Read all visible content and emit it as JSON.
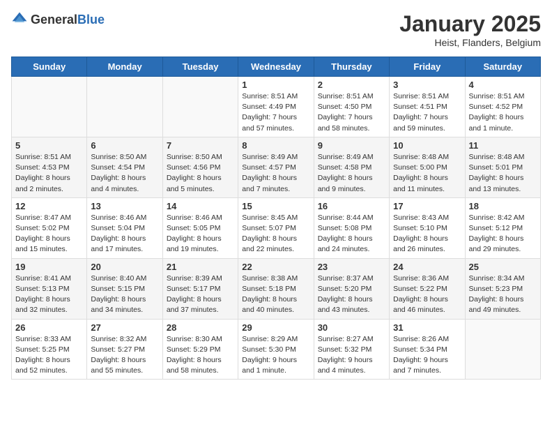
{
  "header": {
    "logo_general": "General",
    "logo_blue": "Blue",
    "month_title": "January 2025",
    "location": "Heist, Flanders, Belgium"
  },
  "days_of_week": [
    "Sunday",
    "Monday",
    "Tuesday",
    "Wednesday",
    "Thursday",
    "Friday",
    "Saturday"
  ],
  "weeks": [
    [
      {
        "day": "",
        "info": ""
      },
      {
        "day": "",
        "info": ""
      },
      {
        "day": "",
        "info": ""
      },
      {
        "day": "1",
        "info": "Sunrise: 8:51 AM\nSunset: 4:49 PM\nDaylight: 7 hours\nand 57 minutes."
      },
      {
        "day": "2",
        "info": "Sunrise: 8:51 AM\nSunset: 4:50 PM\nDaylight: 7 hours\nand 58 minutes."
      },
      {
        "day": "3",
        "info": "Sunrise: 8:51 AM\nSunset: 4:51 PM\nDaylight: 7 hours\nand 59 minutes."
      },
      {
        "day": "4",
        "info": "Sunrise: 8:51 AM\nSunset: 4:52 PM\nDaylight: 8 hours\nand 1 minute."
      }
    ],
    [
      {
        "day": "5",
        "info": "Sunrise: 8:51 AM\nSunset: 4:53 PM\nDaylight: 8 hours\nand 2 minutes."
      },
      {
        "day": "6",
        "info": "Sunrise: 8:50 AM\nSunset: 4:54 PM\nDaylight: 8 hours\nand 4 minutes."
      },
      {
        "day": "7",
        "info": "Sunrise: 8:50 AM\nSunset: 4:56 PM\nDaylight: 8 hours\nand 5 minutes."
      },
      {
        "day": "8",
        "info": "Sunrise: 8:49 AM\nSunset: 4:57 PM\nDaylight: 8 hours\nand 7 minutes."
      },
      {
        "day": "9",
        "info": "Sunrise: 8:49 AM\nSunset: 4:58 PM\nDaylight: 8 hours\nand 9 minutes."
      },
      {
        "day": "10",
        "info": "Sunrise: 8:48 AM\nSunset: 5:00 PM\nDaylight: 8 hours\nand 11 minutes."
      },
      {
        "day": "11",
        "info": "Sunrise: 8:48 AM\nSunset: 5:01 PM\nDaylight: 8 hours\nand 13 minutes."
      }
    ],
    [
      {
        "day": "12",
        "info": "Sunrise: 8:47 AM\nSunset: 5:02 PM\nDaylight: 8 hours\nand 15 minutes."
      },
      {
        "day": "13",
        "info": "Sunrise: 8:46 AM\nSunset: 5:04 PM\nDaylight: 8 hours\nand 17 minutes."
      },
      {
        "day": "14",
        "info": "Sunrise: 8:46 AM\nSunset: 5:05 PM\nDaylight: 8 hours\nand 19 minutes."
      },
      {
        "day": "15",
        "info": "Sunrise: 8:45 AM\nSunset: 5:07 PM\nDaylight: 8 hours\nand 22 minutes."
      },
      {
        "day": "16",
        "info": "Sunrise: 8:44 AM\nSunset: 5:08 PM\nDaylight: 8 hours\nand 24 minutes."
      },
      {
        "day": "17",
        "info": "Sunrise: 8:43 AM\nSunset: 5:10 PM\nDaylight: 8 hours\nand 26 minutes."
      },
      {
        "day": "18",
        "info": "Sunrise: 8:42 AM\nSunset: 5:12 PM\nDaylight: 8 hours\nand 29 minutes."
      }
    ],
    [
      {
        "day": "19",
        "info": "Sunrise: 8:41 AM\nSunset: 5:13 PM\nDaylight: 8 hours\nand 32 minutes."
      },
      {
        "day": "20",
        "info": "Sunrise: 8:40 AM\nSunset: 5:15 PM\nDaylight: 8 hours\nand 34 minutes."
      },
      {
        "day": "21",
        "info": "Sunrise: 8:39 AM\nSunset: 5:17 PM\nDaylight: 8 hours\nand 37 minutes."
      },
      {
        "day": "22",
        "info": "Sunrise: 8:38 AM\nSunset: 5:18 PM\nDaylight: 8 hours\nand 40 minutes."
      },
      {
        "day": "23",
        "info": "Sunrise: 8:37 AM\nSunset: 5:20 PM\nDaylight: 8 hours\nand 43 minutes."
      },
      {
        "day": "24",
        "info": "Sunrise: 8:36 AM\nSunset: 5:22 PM\nDaylight: 8 hours\nand 46 minutes."
      },
      {
        "day": "25",
        "info": "Sunrise: 8:34 AM\nSunset: 5:23 PM\nDaylight: 8 hours\nand 49 minutes."
      }
    ],
    [
      {
        "day": "26",
        "info": "Sunrise: 8:33 AM\nSunset: 5:25 PM\nDaylight: 8 hours\nand 52 minutes."
      },
      {
        "day": "27",
        "info": "Sunrise: 8:32 AM\nSunset: 5:27 PM\nDaylight: 8 hours\nand 55 minutes."
      },
      {
        "day": "28",
        "info": "Sunrise: 8:30 AM\nSunset: 5:29 PM\nDaylight: 8 hours\nand 58 minutes."
      },
      {
        "day": "29",
        "info": "Sunrise: 8:29 AM\nSunset: 5:30 PM\nDaylight: 9 hours\nand 1 minute."
      },
      {
        "day": "30",
        "info": "Sunrise: 8:27 AM\nSunset: 5:32 PM\nDaylight: 9 hours\nand 4 minutes."
      },
      {
        "day": "31",
        "info": "Sunrise: 8:26 AM\nSunset: 5:34 PM\nDaylight: 9 hours\nand 7 minutes."
      },
      {
        "day": "",
        "info": ""
      }
    ]
  ]
}
